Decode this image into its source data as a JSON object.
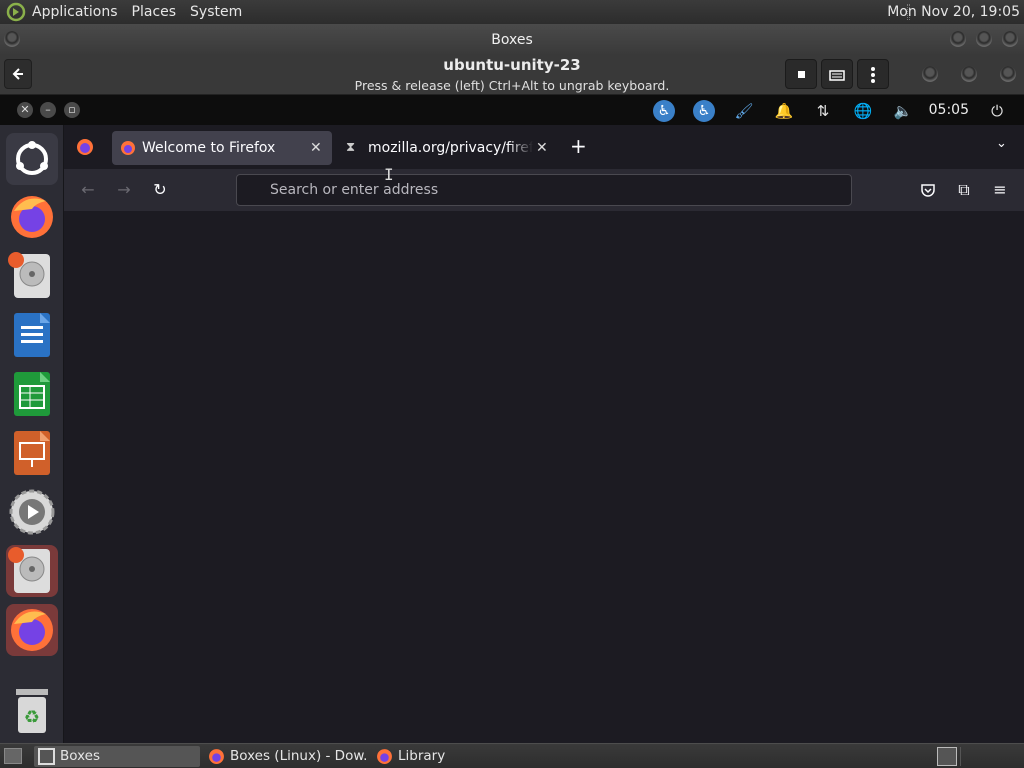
{
  "host_panel": {
    "menus": [
      "Applications",
      "Places",
      "System"
    ],
    "clock": "Mon Nov 20, 19:05",
    "logo_icon": "mate-logo-icon"
  },
  "boxes_window": {
    "title": "Boxes",
    "vm_name": "ubuntu-unity-23",
    "keyboard_hint": "Press & release (left) Ctrl+Alt to ungrab keyboard.",
    "buttons": {
      "back_icon": "back-arrow-icon",
      "stop_icon": "stop-icon",
      "keyboard_icon": "keyboard-icon",
      "menu_icon": "kebab-menu-icon"
    }
  },
  "guest_top_bar": {
    "clock": "05:05",
    "tray_icons": [
      "accessibility-icon",
      "accessibility-icon",
      "brush-icon",
      "bell-icon",
      "network-icon",
      "globe-icon",
      "volume-muted-icon",
      "power-icon"
    ]
  },
  "launcher": {
    "items": [
      "ubuntu-logo",
      "firefox",
      "disks",
      "writer",
      "calc",
      "impress",
      "settings",
      "disks",
      "firefox",
      "trash"
    ]
  },
  "firefox": {
    "tabs": [
      {
        "label": "Welcome to Firefox",
        "selected": true
      },
      {
        "label": "mozilla.org/privacy/firefox/",
        "selected": false
      }
    ],
    "new_tab_label": "+",
    "url_placeholder": "Search or enter address"
  },
  "taskbar": {
    "tasks": [
      {
        "label": "Boxes",
        "active": true
      },
      {
        "label": "Boxes (Linux) - Dow...",
        "active": false
      },
      {
        "label": "Library",
        "active": false
      }
    ]
  },
  "colors": {
    "firefox_bg": "#1c1b22",
    "firefox_toolbar": "#2b2a33",
    "tab_selected": "#42414d",
    "accessibility_blue": "#3a80c8",
    "launcher_bg": "#2c2c34"
  }
}
